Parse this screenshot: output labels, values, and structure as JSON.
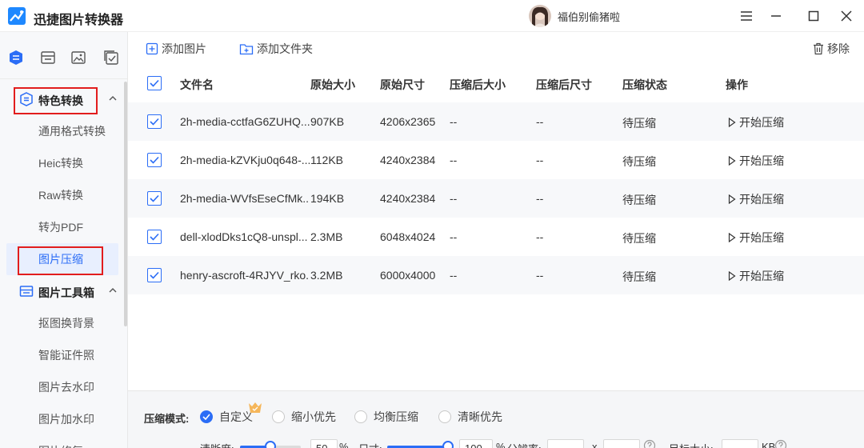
{
  "app": {
    "title": "迅捷图片转换器"
  },
  "user": {
    "name": "福伯别偷猪啦"
  },
  "sidebar": {
    "groups": [
      {
        "label": "特色转换",
        "items": [
          "通用格式转换",
          "Heic转换",
          "Raw转换",
          "转为PDF",
          "图片压缩"
        ]
      },
      {
        "label": "图片工具箱",
        "items": [
          "抠图换背景",
          "智能证件照",
          "图片去水印",
          "图片加水印",
          "图片修复"
        ]
      }
    ]
  },
  "toolbar": {
    "add_image": "添加图片",
    "add_folder": "添加文件夹",
    "remove": "移除"
  },
  "table": {
    "headers": [
      "文件名",
      "原始大小",
      "原始尺寸",
      "压缩后大小",
      "压缩后尺寸",
      "压缩状态",
      "操作"
    ],
    "rows": [
      {
        "name": "2h-media-cctfaG6ZUHQ...",
        "size": "907KB",
        "dims": "4206x2365",
        "new_size": "--",
        "new_dims": "--",
        "status": "待压缩",
        "action": "开始压缩"
      },
      {
        "name": "2h-media-kZVKju0q648-...",
        "size": "112KB",
        "dims": "4240x2384",
        "new_size": "--",
        "new_dims": "--",
        "status": "待压缩",
        "action": "开始压缩"
      },
      {
        "name": "2h-media-WVfsEseCfMk...",
        "size": "194KB",
        "dims": "4240x2384",
        "new_size": "--",
        "new_dims": "--",
        "status": "待压缩",
        "action": "开始压缩"
      },
      {
        "name": "dell-xlodDks1cQ8-unspl...",
        "size": "2.3MB",
        "dims": "6048x4024",
        "new_size": "--",
        "new_dims": "--",
        "status": "待压缩",
        "action": "开始压缩"
      },
      {
        "name": "henry-ascroft-4RJYV_rko...",
        "size": "3.2MB",
        "dims": "6000x4000",
        "new_size": "--",
        "new_dims": "--",
        "status": "待压缩",
        "action": "开始压缩"
      }
    ]
  },
  "bottom": {
    "mode_label": "压缩模式:",
    "modes": [
      "自定义",
      "缩小优先",
      "均衡压缩",
      "清晰优先"
    ],
    "selected_mode": "自定义",
    "clarity_label": "清晰度:",
    "clarity_value": "50",
    "clarity_unit": "%",
    "clarity_fraction": 0.5,
    "size_label": "尺寸:",
    "size_value": "100",
    "size_unit": "%",
    "size_fraction": 1.0,
    "resolution_label": "分辨率:",
    "resolution_sep": "x",
    "target_label": "目标大小:",
    "target_unit": "KB"
  },
  "colors": {
    "accent": "#2b6df6",
    "highlight_box": "#e21d1d"
  }
}
